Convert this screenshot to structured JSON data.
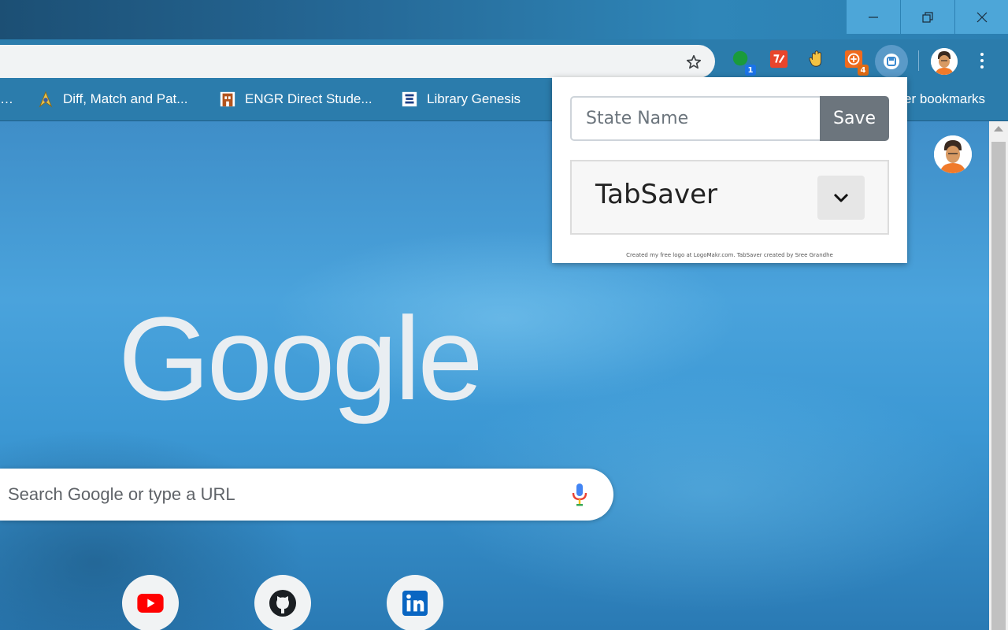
{
  "browser": {
    "window_controls": {
      "minimize": "minimize",
      "maximize": "restore",
      "close": "close"
    },
    "extensions": [
      {
        "name": "green-chat-extension",
        "badge": "1",
        "color": "#1a9b3c",
        "badge_color": "#1a73e8"
      },
      {
        "name": "red-extension",
        "badge": "",
        "color": "#e8452c"
      },
      {
        "name": "hand-extension",
        "badge": "",
        "color": "#f3c242"
      },
      {
        "name": "orange-extension",
        "badge": "4",
        "color": "#f06a1d",
        "badge_color": "#e06b14"
      }
    ],
    "active_extension": "tabsaver"
  },
  "bookmarks": [
    {
      "label": "…",
      "icon": "ellipsis"
    },
    {
      "label": "Diff, Match and Pat...",
      "icon": "star-trek-icon"
    },
    {
      "label": "ENGR Direct Stude...",
      "icon": "building-icon"
    },
    {
      "label": "Library Genesis",
      "icon": "book-icon"
    },
    {
      "label": "er bookmarks",
      "icon": ""
    }
  ],
  "ntp": {
    "logo": "Google",
    "search_placeholder": "Search Google or type a URL",
    "shortcuts": [
      "youtube",
      "github",
      "linkedin"
    ]
  },
  "popup": {
    "input_placeholder": "State Name",
    "save_label": "Save",
    "card_title": "TabSaver",
    "credit": "Created my free logo at LogoMakr.com. TabSaver created by Sree Grandhe"
  }
}
